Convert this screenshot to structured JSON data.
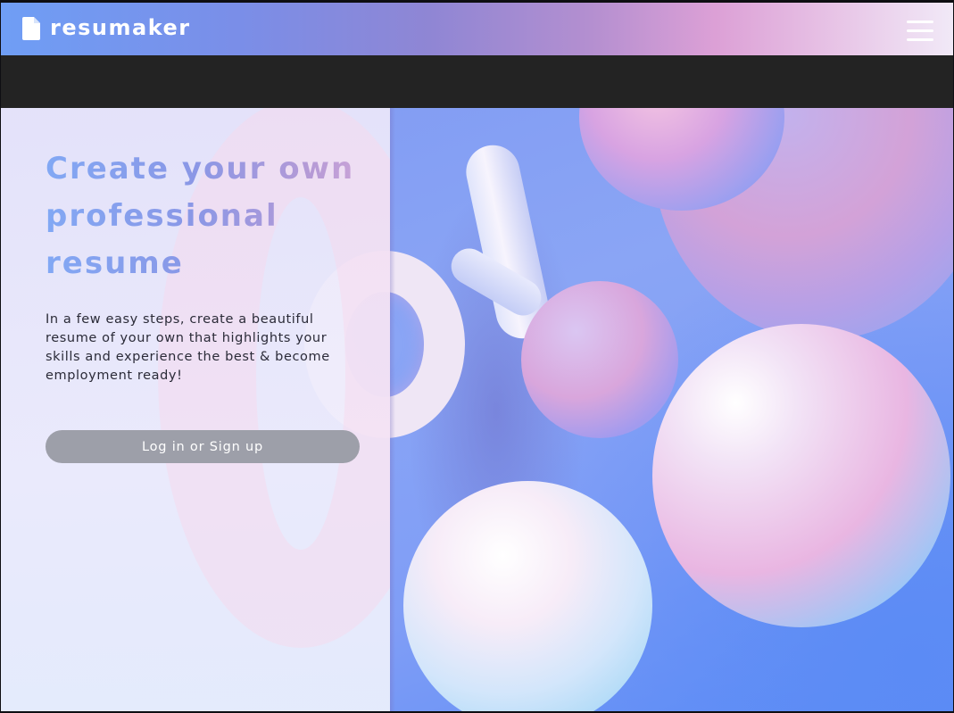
{
  "header": {
    "logo_icon": "document-icon",
    "brand": "resumaker",
    "menu_icon": "hamburger-menu-icon"
  },
  "hero": {
    "headline": "Create your own professional resume",
    "description": "In a few easy steps, create a beautiful resume of your own that highlights your skills and experience the best & become employment ready!",
    "cta_label": "Log in or Sign up"
  },
  "colors": {
    "header_gradient_start": "#6f9ef5",
    "header_gradient_mid": "#dca0d6",
    "header_gradient_end": "#f1e9f7",
    "band": "#232323",
    "cta_background": "#9d9fa9"
  }
}
